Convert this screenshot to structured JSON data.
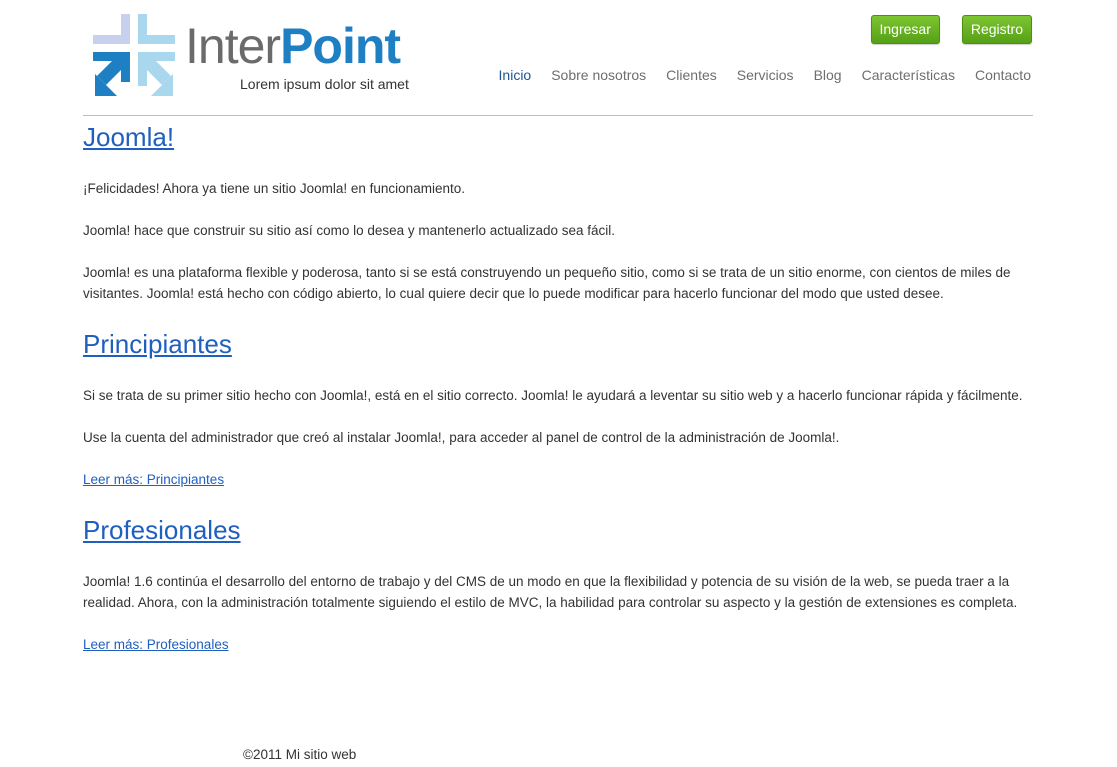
{
  "header": {
    "logo": {
      "word1": "Inter",
      "word2": "Point",
      "tagline": "Lorem ipsum dolor sit amet"
    },
    "auth": {
      "login_label": "Ingresar",
      "register_label": "Registro"
    },
    "nav": [
      {
        "label": "Inicio",
        "active": true
      },
      {
        "label": "Sobre nosotros",
        "active": false
      },
      {
        "label": "Clientes",
        "active": false
      },
      {
        "label": "Servicios",
        "active": false
      },
      {
        "label": "Blog",
        "active": false
      },
      {
        "label": "Características",
        "active": false
      },
      {
        "label": "Contacto",
        "active": false
      }
    ]
  },
  "sections": [
    {
      "title": "Joomla!",
      "paragraphs": [
        "¡Felicidades! Ahora ya tiene un sitio Joomla! en funcionamiento.",
        "Joomla! hace que construir su sitio así como lo desea y mantenerlo actualizado sea fácil.",
        "Joomla! es una plataforma flexible y poderosa, tanto si se está construyendo un pequeño sitio, como si se trata de un sitio enorme, con cientos de miles de visitantes. Joomla! está hecho con código abierto, lo cual quiere decir que lo puede modificar para hacerlo funcionar del modo que usted desee."
      ]
    },
    {
      "title": "Principiantes",
      "paragraphs": [
        "Si se trata de su primer sitio hecho con Joomla!, está en el sitio correcto. Joomla! le ayudará a leventar su sitio web y a hacerlo funcionar rápida y fácilmente.",
        "Use la cuenta del administrador que creó al instalar Joomla!, para acceder al panel de control de la administración de Joomla!."
      ],
      "readmore": "Leer más: Principiantes"
    },
    {
      "title": "Profesionales",
      "paragraphs": [
        "Joomla! 1.6 continúa el desarrollo del entorno de trabajo y del CMS de un modo en que la flexibilidad y potencia de su visión de la web, se pueda traer a la realidad. Ahora, con la administración totalmente siguiendo el estilo de MVC, la habilidad para controlar su aspecto y la gestión de extensiones es completa."
      ],
      "readmore": "Leer más: Profesionales"
    }
  ],
  "footer": {
    "copyright": "©2011 Mi sitio web"
  },
  "colors": {
    "brand_blue": "#1f7fc3",
    "brand_gray": "#6b6b6b",
    "link": "#1f5fbf",
    "button_green": "#5fa81d",
    "nav_active": "#205493"
  }
}
